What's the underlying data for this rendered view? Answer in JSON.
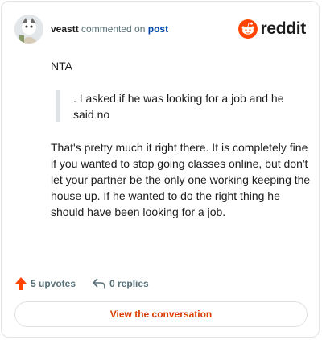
{
  "comment": {
    "username": "veastt",
    "action_text": "commented on",
    "target_link": "post",
    "paragraph_1": "NTA",
    "quote": ". I asked if he was looking for a job and he said no",
    "paragraph_2": "That's pretty much it right there. It is completely fine if you wanted to stop going classes online, but don't let your partner be the only one working keeping the house up. If he wanted to do the right thing he should have been looking for a job."
  },
  "brand": {
    "wordmark": "reddit",
    "color": "#ff4500",
    "icon": "reddit-snoo-icon"
  },
  "actions": {
    "upvotes_label": "5 upvotes",
    "upvote_icon": "upvote-arrow-icon",
    "upvote_color": "#ff4500",
    "replies_label": "0 replies",
    "reply_icon": "reply-arrow-icon"
  },
  "footer": {
    "view_conversation_label": "View the conversation",
    "accent_color": "#d93a00"
  }
}
